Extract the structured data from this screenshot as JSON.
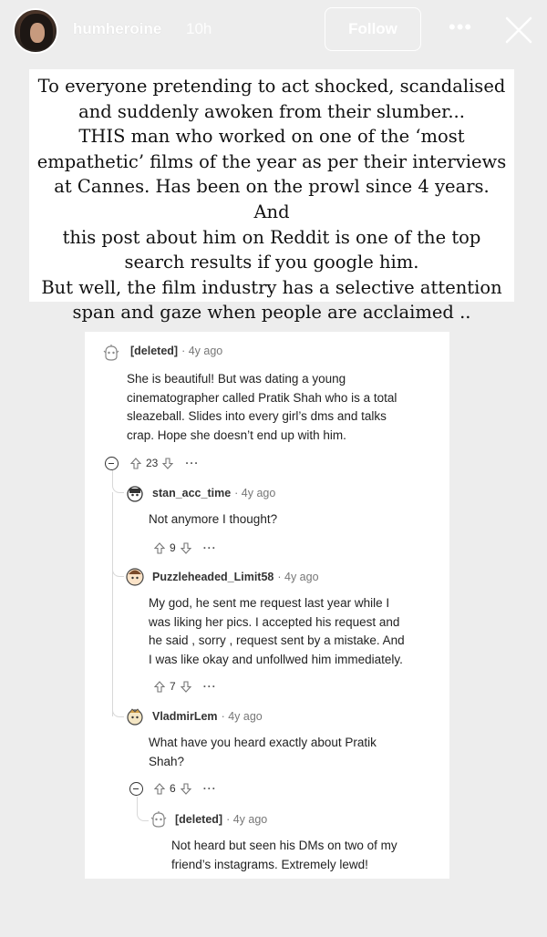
{
  "header": {
    "username": "humheroine",
    "time": "10h",
    "follow_label": "Follow",
    "more_label": "•••"
  },
  "caption": {
    "lines": [
      "To everyone pretending to act shocked, scandalised",
      "and suddenly awoken from their slumber...",
      "THIS man who worked on one of the ‘most",
      "empathetic’ films of the year as per their interviews",
      "at Cannes. Has been on the prowl since 4 years. And",
      "this post about him on Reddit is one of the top",
      "search results if you google him.",
      "But well, the film industry has a selective attention",
      "span and gaze when people are acclaimed .."
    ]
  },
  "comments": [
    {
      "user": "[deleted]",
      "time": "· 4y ago",
      "text": [
        "She is beautiful! But was dating a young",
        "cinematographer called Pratik Shah who is a total",
        "sleazeball. Slides into every girl’s dms and talks",
        "crap. Hope she doesn’t end up with him."
      ],
      "votes": "23",
      "more": "···"
    },
    {
      "user": "stan_acc_time",
      "time": "· 4y ago",
      "text": [
        "Not anymore I thought?"
      ],
      "votes": "9",
      "more": "···"
    },
    {
      "user": "Puzzleheaded_Limit58",
      "time": "· 4y ago",
      "text": [
        "My god, he sent me request last year while I",
        "was liking her pics. I accepted his request and",
        "he said , sorry , request sent by a mistake. And",
        "I was like okay and unfollwed him immediately."
      ],
      "votes": "7",
      "more": "···"
    },
    {
      "user": "VladmirLem",
      "time": "· 4y ago",
      "text": [
        "What have you heard exactly about Pratik",
        "Shah?"
      ],
      "votes": "6",
      "more": "···"
    },
    {
      "user": "[deleted]",
      "time": "· 4y ago",
      "text": [
        "Not heard but seen his DMs on two of my",
        "friend’s instagrams. Extremely lewd!"
      ]
    }
  ]
}
